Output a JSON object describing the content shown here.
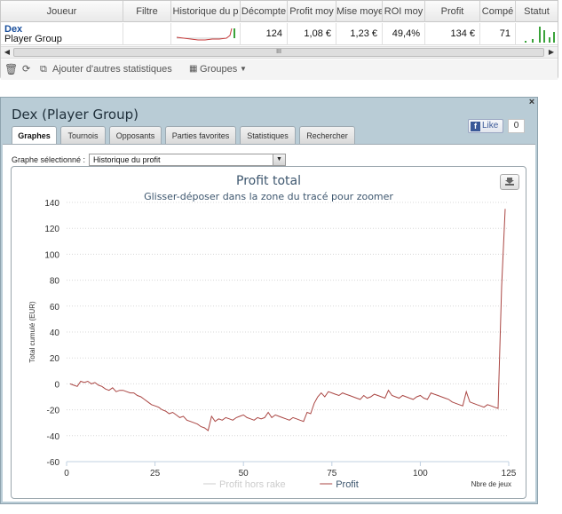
{
  "grid": {
    "headers": [
      "Joueur",
      "Filtre",
      "Historique du p",
      "Décompte",
      "Profit moy",
      "Mise moye",
      "ROI moy",
      "Profit",
      "Compé",
      "Statut"
    ],
    "row": {
      "player_name": "Dex",
      "player_group": "Player Group",
      "filter": "",
      "count": "124",
      "avg_profit": "1,08 €",
      "avg_stake": "1,23 €",
      "avg_roi": "49,4%",
      "profit": "134 €",
      "competitions": "71"
    },
    "scroll_mid": "III",
    "toolbar": {
      "add_stats": "Ajouter d'autres statistiques",
      "groups": "Groupes"
    }
  },
  "dialog": {
    "title": "Dex (Player Group)",
    "close": "×",
    "like_label": "Like",
    "like_count": "0",
    "tabs": [
      "Graphes",
      "Tournois",
      "Opposants",
      "Parties favorites",
      "Statistiques",
      "Rechercher"
    ],
    "active_tab": 0,
    "selected_chart_label": "Graphe sélectionné :",
    "selected_chart_value": "Historique du profit"
  },
  "chart_data": {
    "type": "line",
    "title": "Profit total",
    "subtitle": "Glisser-déposer dans la zone du tracé pour zoomer",
    "xlabel": "Nbre de jeux",
    "ylabel": "Total cumulé (EUR)",
    "xlim": [
      0,
      125
    ],
    "ylim": [
      -60,
      140
    ],
    "xticks": [
      0,
      25,
      50,
      75,
      100,
      125
    ],
    "yticks": [
      -60,
      -40,
      -20,
      0,
      20,
      40,
      60,
      80,
      100,
      120,
      140
    ],
    "grid": true,
    "legend_position": "bottom-center",
    "series": [
      {
        "name": "Profit hors rake",
        "color": "#cccccc",
        "visible": false,
        "x": [],
        "y": []
      },
      {
        "name": "Profit",
        "color": "#aa4643",
        "visible": true,
        "x": [
          1,
          2,
          3,
          4,
          5,
          6,
          7,
          8,
          9,
          10,
          11,
          12,
          13,
          14,
          15,
          16,
          17,
          18,
          19,
          20,
          21,
          22,
          23,
          24,
          25,
          26,
          27,
          28,
          29,
          30,
          31,
          32,
          33,
          34,
          35,
          36,
          37,
          38,
          39,
          40,
          41,
          42,
          43,
          44,
          45,
          46,
          47,
          48,
          49,
          50,
          51,
          52,
          53,
          54,
          55,
          56,
          57,
          58,
          59,
          60,
          61,
          62,
          63,
          64,
          65,
          66,
          67,
          68,
          69,
          70,
          71,
          72,
          73,
          74,
          75,
          76,
          77,
          78,
          79,
          80,
          81,
          82,
          83,
          84,
          85,
          86,
          87,
          88,
          89,
          90,
          91,
          92,
          93,
          94,
          95,
          96,
          97,
          98,
          99,
          100,
          101,
          102,
          103,
          104,
          105,
          106,
          107,
          108,
          109,
          110,
          111,
          112,
          113,
          114,
          115,
          116,
          117,
          118,
          119,
          120,
          121,
          122,
          123,
          124
        ],
        "y": [
          0,
          -1,
          -2,
          2,
          1,
          2,
          0,
          1,
          -1,
          -2,
          -4,
          -5,
          -3,
          -6,
          -5,
          -5,
          -6,
          -7,
          -7,
          -9,
          -10,
          -12,
          -14,
          -16,
          -17,
          -18,
          -20,
          -21,
          -23,
          -22,
          -24,
          -26,
          -25,
          -28,
          -29,
          -30,
          -31,
          -33,
          -34,
          -36,
          -25,
          -29,
          -27,
          -28,
          -26,
          -27,
          -28,
          -26,
          -25,
          -24,
          -26,
          -27,
          -28,
          -26,
          -27,
          -26,
          -22,
          -26,
          -24,
          -25,
          -26,
          -27,
          -28,
          -26,
          -27,
          -28,
          -29,
          -22,
          -23,
          -15,
          -10,
          -7,
          -10,
          -6,
          -7,
          -8,
          -9,
          -7,
          -8,
          -9,
          -10,
          -11,
          -12,
          -9,
          -11,
          -10,
          -8,
          -9,
          -10,
          -11,
          -5,
          -9,
          -10,
          -11,
          -9,
          -10,
          -11,
          -12,
          -10,
          -9,
          -11,
          -12,
          -7,
          -8,
          -9,
          -10,
          -11,
          -12,
          -14,
          -15,
          -16,
          -17,
          -6,
          -14,
          -15,
          -16,
          -17,
          -18,
          -16,
          -17,
          -18,
          -19,
          75,
          135
        ]
      }
    ]
  }
}
